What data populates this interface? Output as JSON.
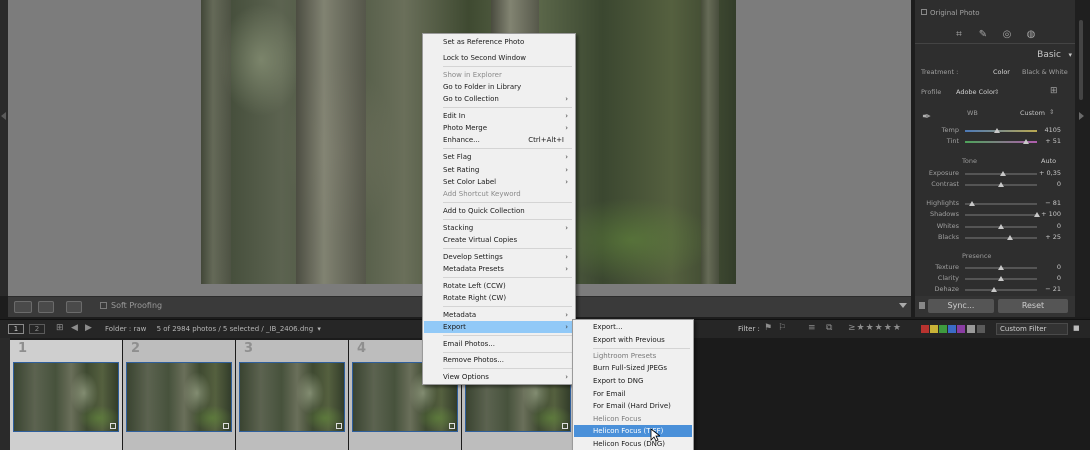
{
  "right_panel": {
    "original_photo": "Original Photo",
    "section_title": "Basic",
    "treatment_label": "Treatment :",
    "treatment_color": "Color",
    "treatment_bw": "Black & White",
    "profile_label": "Profile",
    "profile_value": "Adobe Color",
    "wb_label": "WB",
    "wb_value": "Custom",
    "tone_label": "Tone",
    "tone_auto": "Auto",
    "presence_label": "Presence",
    "sliders": [
      {
        "label": "Temp",
        "value": "4105",
        "pos": 0.45
      },
      {
        "label": "Tint",
        "value": "+ 51",
        "pos": 0.85
      },
      {
        "label": "Exposure",
        "value": "+ 0,35",
        "pos": 0.53
      },
      {
        "label": "Contrast",
        "value": "0",
        "pos": 0.5
      },
      {
        "label": "Highlights",
        "value": "− 81",
        "pos": 0.1
      },
      {
        "label": "Shadows",
        "value": "+ 100",
        "pos": 1.0
      },
      {
        "label": "Whites",
        "value": "0",
        "pos": 0.5
      },
      {
        "label": "Blacks",
        "value": "+ 25",
        "pos": 0.62
      },
      {
        "label": "Texture",
        "value": "0",
        "pos": 0.5
      },
      {
        "label": "Clarity",
        "value": "0",
        "pos": 0.5
      },
      {
        "label": "Dehaze",
        "value": "− 21",
        "pos": 0.4
      }
    ],
    "sync_label": "Sync...",
    "reset_label": "Reset"
  },
  "toolbar": {
    "soft_proofing": "Soft Proofing"
  },
  "filmstrip_bar": {
    "screen1": "1",
    "screen2": "2",
    "folder_label": "Folder : raw",
    "photo_count": "5 of 2984 photos / 5 selected / _IB_2406.dng",
    "filter_label": "Filter :",
    "custom_filter": "Custom Filter"
  },
  "filmstrip": {
    "cells": [
      {
        "num": "1"
      },
      {
        "num": "2"
      },
      {
        "num": "3"
      },
      {
        "num": "4"
      },
      {
        "num": ""
      }
    ]
  },
  "context_menu": {
    "items": [
      {
        "label": "Set as Reference Photo"
      },
      {
        "label": "Lock to Second Window"
      },
      {
        "label": "Show in Explorer"
      },
      {
        "label": "Go to Folder in Library"
      },
      {
        "label": "Go to Collection"
      },
      {
        "label": "Edit In"
      },
      {
        "label": "Photo Merge"
      },
      {
        "label": "Enhance...",
        "shortcut": "Ctrl+Alt+I"
      },
      {
        "label": "Set Flag"
      },
      {
        "label": "Set Rating"
      },
      {
        "label": "Set Color Label"
      },
      {
        "label": "Add Shortcut Keyword"
      },
      {
        "label": "Add to Quick Collection"
      },
      {
        "label": "Stacking"
      },
      {
        "label": "Create Virtual Copies"
      },
      {
        "label": "Develop Settings"
      },
      {
        "label": "Metadata Presets"
      },
      {
        "label": "Rotate Left (CCW)"
      },
      {
        "label": "Rotate Right (CW)"
      },
      {
        "label": "Metadata"
      },
      {
        "label": "Export"
      },
      {
        "label": "Email Photos..."
      },
      {
        "label": "Remove Photos..."
      },
      {
        "label": "View Options"
      }
    ]
  },
  "export_submenu": {
    "items": [
      {
        "label": "Export..."
      },
      {
        "label": "Export with Previous"
      },
      {
        "label": "Lightroom Presets"
      },
      {
        "label": "Burn Full-Sized JPEGs"
      },
      {
        "label": "Export to DNG"
      },
      {
        "label": "For Email"
      },
      {
        "label": "For Email (Hard Drive)"
      },
      {
        "label": "Helicon Focus"
      },
      {
        "label": "Helicon Focus (TIFF)"
      },
      {
        "label": "Helicon Focus (DNG)"
      }
    ]
  }
}
